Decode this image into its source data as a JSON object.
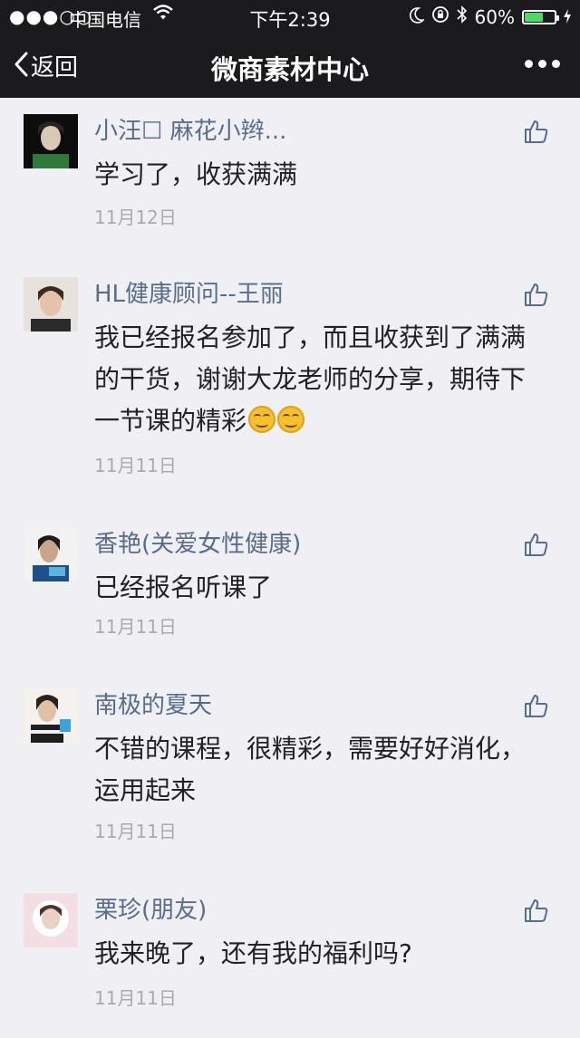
{
  "status": {
    "signal": "●●●○○",
    "carrier": "中国电信",
    "time": "下午2:39",
    "battery": "60%",
    "battery_level": 0.6
  },
  "nav": {
    "back_label": "返回",
    "title": "微商素材中心"
  },
  "comments": [
    {
      "nick": "小汪☐ 麻花小辫...",
      "text": "学习了，收获满满",
      "date": "11月12日"
    },
    {
      "nick": "HL健康顾问--王丽",
      "text": "我已经报名参加了，而且收获到了满满的干货，谢谢大龙老师的分享，期待下一节课的精彩",
      "date": "11月11日"
    },
    {
      "nick": "香艳(关爱女性健康)",
      "text": "已经报名听课了",
      "date": "11月11日"
    },
    {
      "nick": "南极的夏天",
      "text": "不错的课程，很精彩，需要好好消化，运用起来",
      "date": "11月11日"
    },
    {
      "nick": "栗珍(朋友)",
      "text": "我来晚了，还有我的福利吗?",
      "date": "11月11日"
    }
  ]
}
